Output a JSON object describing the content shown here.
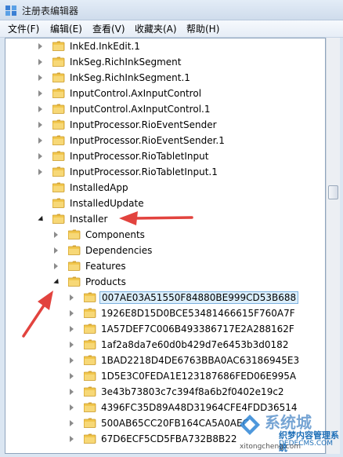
{
  "window": {
    "title": "注册表编辑器"
  },
  "menu": [
    "文件(F)",
    "编辑(E)",
    "查看(V)",
    "收藏夹(A)",
    "帮助(H)"
  ],
  "tree": [
    {
      "label": "InkEd.InkEdit.1",
      "level": 0,
      "state": "collapsed"
    },
    {
      "label": "InkSeg.RichInkSegment",
      "level": 0,
      "state": "collapsed"
    },
    {
      "label": "InkSeg.RichInkSegment.1",
      "level": 0,
      "state": "collapsed"
    },
    {
      "label": "InputControl.AxInputControl",
      "level": 0,
      "state": "collapsed"
    },
    {
      "label": "InputControl.AxInputControl.1",
      "level": 0,
      "state": "collapsed"
    },
    {
      "label": "InputProcessor.RioEventSender",
      "level": 0,
      "state": "collapsed"
    },
    {
      "label": "InputProcessor.RioEventSender.1",
      "level": 0,
      "state": "collapsed"
    },
    {
      "label": "InputProcessor.RioTabletInput",
      "level": 0,
      "state": "collapsed"
    },
    {
      "label": "InputProcessor.RioTabletInput.1",
      "level": 0,
      "state": "collapsed"
    },
    {
      "label": "InstalledApp",
      "level": 0,
      "state": "none"
    },
    {
      "label": "InstalledUpdate",
      "level": 0,
      "state": "none"
    },
    {
      "label": "Installer",
      "level": 0,
      "state": "expanded"
    },
    {
      "label": "Components",
      "level": 1,
      "state": "collapsed"
    },
    {
      "label": "Dependencies",
      "level": 1,
      "state": "collapsed"
    },
    {
      "label": "Features",
      "level": 1,
      "state": "collapsed"
    },
    {
      "label": "Products",
      "level": 1,
      "state": "expanded"
    },
    {
      "label": "007AE03A51550F84880BE999CD53B688",
      "level": 2,
      "state": "collapsed",
      "selected": true
    },
    {
      "label": "1926E8D15D0BCE53481466615F760A7F",
      "level": 2,
      "state": "collapsed"
    },
    {
      "label": "1A57DEF7C006B493386717E2A288162F",
      "level": 2,
      "state": "collapsed"
    },
    {
      "label": "1af2a8da7e60d0b429d7e6453b3d0182",
      "level": 2,
      "state": "collapsed"
    },
    {
      "label": "1BAD2218D4DE6763BBA0AC63186945E3",
      "level": 2,
      "state": "collapsed"
    },
    {
      "label": "1D5E3C0FEDA1E123187686FED06E995A",
      "level": 2,
      "state": "collapsed"
    },
    {
      "label": "3e43b73803c7c394f8a6b2f0402e19c2",
      "level": 2,
      "state": "collapsed"
    },
    {
      "label": "4396FC35D89A48D31964CFE4FDD36514",
      "level": 2,
      "state": "collapsed"
    },
    {
      "label": "500AB65CC20FB164CA5A0AEC",
      "level": 2,
      "state": "collapsed"
    },
    {
      "label": "67D6ECF5CD5FBA732B8B22",
      "level": 2,
      "state": "collapsed"
    }
  ],
  "watermark": {
    "brand": "系统城",
    "line1": "织梦内容管理系统",
    "line2": "DEDECMS.COM",
    "url": "xitongcheng.com"
  }
}
